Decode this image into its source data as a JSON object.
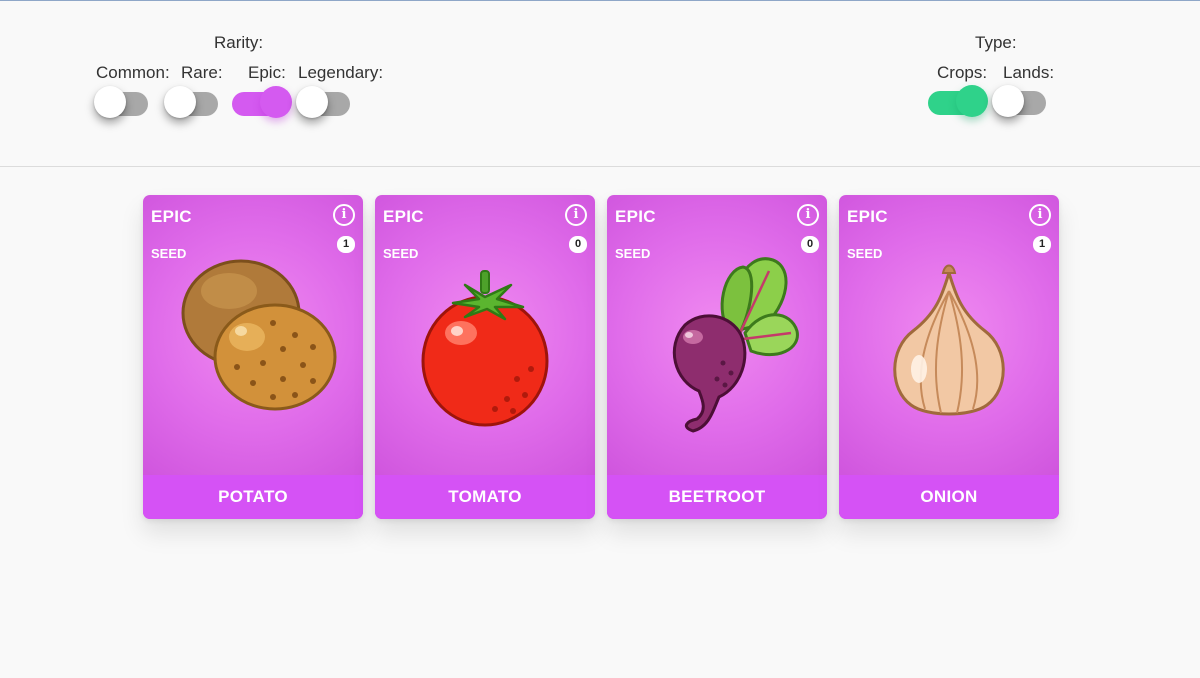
{
  "filters": {
    "rarity": {
      "title": "Rarity:",
      "options": [
        {
          "label": "Common:",
          "on": false
        },
        {
          "label": "Rare:",
          "on": false
        },
        {
          "label": "Epic:",
          "on": true,
          "color": "#d45af0"
        },
        {
          "label": "Legendary:",
          "on": false
        }
      ]
    },
    "type": {
      "title": "Type:",
      "options": [
        {
          "label": "Crops:",
          "on": true,
          "color": "#2fd28a"
        },
        {
          "label": "Lands:",
          "on": false
        }
      ]
    }
  },
  "cards": [
    {
      "rarity": "EPIC",
      "type": "SEED",
      "count": "1",
      "name": "POTATO",
      "icon": "potato-icon"
    },
    {
      "rarity": "EPIC",
      "type": "SEED",
      "count": "0",
      "name": "TOMATO",
      "icon": "tomato-icon"
    },
    {
      "rarity": "EPIC",
      "type": "SEED",
      "count": "0",
      "name": "BEETROOT",
      "icon": "beetroot-icon"
    },
    {
      "rarity": "EPIC",
      "type": "SEED",
      "count": "1",
      "name": "ONION",
      "icon": "onion-icon"
    }
  ],
  "colors": {
    "epic_card": "#e06cea",
    "epic_footer": "#d552f5",
    "toggle_off": "#a8a8a8"
  }
}
